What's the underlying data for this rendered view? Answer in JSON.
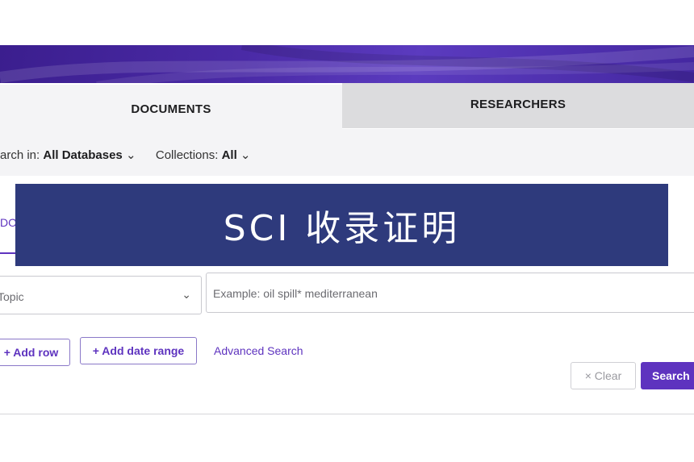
{
  "tabs": {
    "documents": "DOCUMENTS",
    "researchers": "RESEARCHERS"
  },
  "filters": {
    "search_in_label": "arch in:",
    "search_in_value": "All Databases",
    "collections_label": "Collections:",
    "collections_value": "All",
    "chevron": "⌄"
  },
  "subtab": {
    "label": "DO"
  },
  "overlay": {
    "text": "SCI 收录证明"
  },
  "search_row": {
    "field_select": "Topic",
    "field_chevron": "⌄",
    "query_placeholder": "Example: oil spill* mediterranean",
    "query_value": ""
  },
  "actions": {
    "add_row": "+ Add row",
    "add_date_range": "+ Add date range",
    "advanced_search": "Advanced Search",
    "clear": "× Clear",
    "search": "Search"
  },
  "colors": {
    "brand_purple": "#5e33bf",
    "overlay_navy": "#2e3a7c",
    "banner_purple": "#4a2aa6"
  }
}
